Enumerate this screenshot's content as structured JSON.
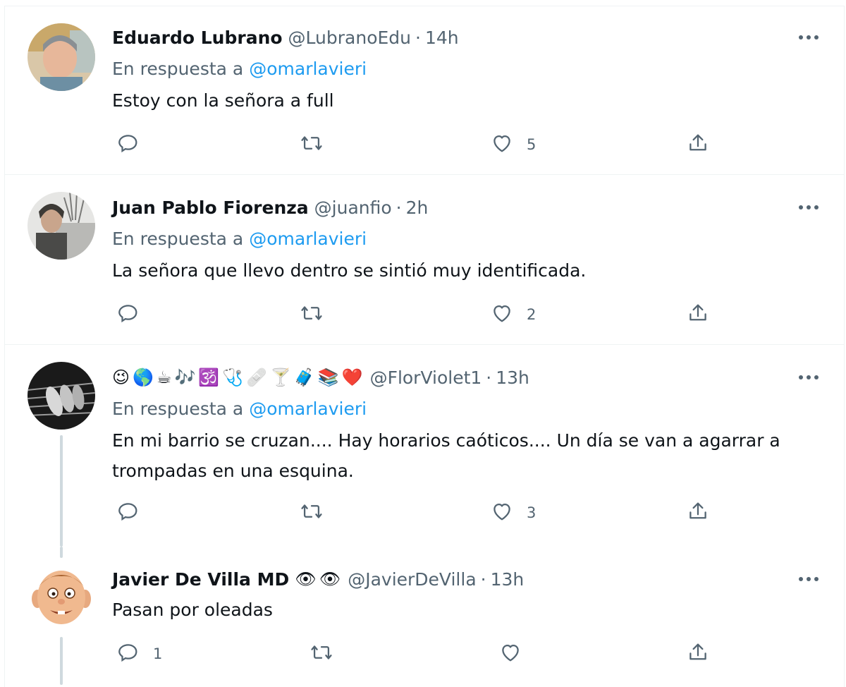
{
  "tweets": [
    {
      "name": "Eduardo Lubrano",
      "handle": "@LubranoEdu",
      "time": "14h",
      "replying_prefix": "En respuesta a",
      "replying_to": "@omarlavieri",
      "text": "Estoy con la señora a full",
      "reply_count": "",
      "like_count": "5"
    },
    {
      "name": "Juan Pablo Fiorenza",
      "handle": "@juanfio",
      "time": "2h",
      "replying_prefix": "En respuesta a",
      "replying_to": "@omarlavieri",
      "text": "La señora que llevo dentro se sintió muy identificada.",
      "reply_count": "",
      "like_count": "2"
    },
    {
      "name": "",
      "name_emojis": [
        "😉",
        "🌎",
        "☕",
        "🎶",
        "🕉️",
        "🩺",
        "🩹",
        "🍸",
        "🧳",
        "📚",
        "❤️"
      ],
      "handle": "@FlorViolet1",
      "time": "13h",
      "replying_prefix": "En respuesta a",
      "replying_to": "@omarlavieri",
      "text": "En mi barrio se cruzan.... Hay horarios caóticos.... Un día se van a agarrar a trompadas en una esquina.",
      "reply_count": "",
      "like_count": "3"
    },
    {
      "name": "Javier De Villa MD",
      "name_emojis": [
        "👁",
        "👁"
      ],
      "handle": "@JavierDeVilla",
      "time": "13h",
      "text": "Pasan por oleadas",
      "reply_count": "1",
      "like_count": ""
    }
  ],
  "icons": {
    "reply": "reply-icon",
    "retweet": "retweet-icon",
    "like": "like-icon",
    "share": "share-icon",
    "more": "more-icon"
  },
  "colors": {
    "accent": "#1d9bf0",
    "secondary_text": "#536471",
    "thread_line": "#cfd9de"
  },
  "separator": "·"
}
